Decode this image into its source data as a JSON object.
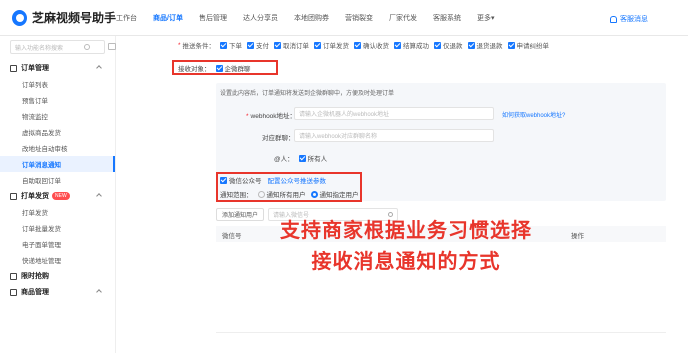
{
  "app": {
    "title": "芝麻视频号助手"
  },
  "nav": {
    "items": [
      "工作台",
      "商品/订单",
      "售后管理",
      "达人分享员",
      "本地团购券",
      "营销裂变",
      "厂家代发",
      "客服系统",
      "更多▾"
    ],
    "active_index": 1
  },
  "topright": {
    "label": "客服消息"
  },
  "sidebar": {
    "search_placeholder": "输入功能名称搜索",
    "groups": [
      {
        "label": "订单管理",
        "items": [
          "订单列表",
          "预售订单",
          "物流监控",
          "虚拟商品发货",
          "改地址自动审核",
          "订单消息通知",
          "自助取回订单"
        ],
        "selected": "订单消息通知"
      },
      {
        "label": "打单发货",
        "badge": "NEW",
        "items": [
          "打单发货",
          "订单批量发货",
          "电子面单管理",
          "快递地址管理"
        ]
      },
      {
        "label": "限时抢购",
        "items": []
      },
      {
        "label": "商品管理",
        "items": []
      }
    ]
  },
  "main": {
    "push_conditions": {
      "label": "推送条件：",
      "options": [
        "下单",
        "支付",
        "取消订单",
        "订单发货",
        "确认收货",
        "结算成功",
        "仅退款",
        "退货退款",
        "申请纠纷单"
      ]
    },
    "receiver": {
      "label": "接收对象：",
      "option": "企微群聊"
    },
    "panel": {
      "hint": "设置此内容后，订单通知将发送到企微群聊中，方便及时处理订单",
      "webhook_label": "webhook地址：",
      "webhook_placeholder": "请输入企微机器人的webhook地址",
      "webhook_link": "如何获取webhook地址?",
      "group_label": "对应群聊：",
      "group_placeholder": "请输入webhook对应群聊名称",
      "at_label": "@人：",
      "at_option": "所有人"
    },
    "wechat": {
      "label": "微信公众号",
      "link": "配置公众号推送参数"
    },
    "scope": {
      "label": "通知范围：",
      "options": [
        "通知所有用户",
        "通知指定用户"
      ],
      "selected": "通知指定用户"
    },
    "add_button": "添加通知用户",
    "search_placeholder": "请输入微信号",
    "table": {
      "columns": [
        "微信号",
        "操作"
      ]
    },
    "overlay": {
      "line1": "支持商家根据业务习惯选择",
      "line2": "接收消息通知的方式"
    }
  }
}
